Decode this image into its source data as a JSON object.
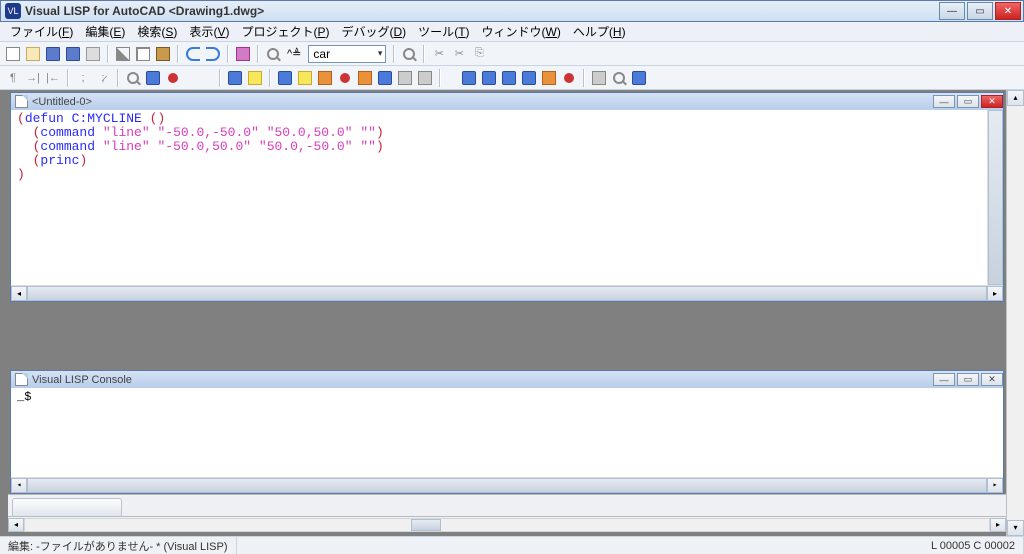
{
  "window": {
    "title": "Visual LISP for AutoCAD <Drawing1.dwg>"
  },
  "menu": [
    {
      "label": "ファイル",
      "accel": "F"
    },
    {
      "label": "編集",
      "accel": "E"
    },
    {
      "label": "検索",
      "accel": "S"
    },
    {
      "label": "表示",
      "accel": "V"
    },
    {
      "label": "プロジェクト",
      "accel": "P"
    },
    {
      "label": "デバッグ",
      "accel": "D"
    },
    {
      "label": "ツール",
      "accel": "T"
    },
    {
      "label": "ウィンドウ",
      "accel": "W"
    },
    {
      "label": "ヘルプ",
      "accel": "H"
    }
  ],
  "combo": {
    "value": "car"
  },
  "editor": {
    "title": "<Untitled-0>",
    "code": {
      "l1_kw": "defun",
      "l1_name": "C:MYCLINE",
      "l2_kw": "command",
      "l2_a": "\"line\"",
      "l2_b": "\"-50.0,-50.0\"",
      "l2_c": "\"50.0,50.0\"",
      "l2_d": "\"\"",
      "l3_kw": "command",
      "l3_a": "\"line\"",
      "l3_b": "\"-50.0,50.0\"",
      "l3_c": "\"50.0,-50.0\"",
      "l3_d": "\"\"",
      "l4_kw": "princ"
    }
  },
  "console": {
    "title": "Visual LISP Console",
    "prompt": "_$"
  },
  "status": {
    "edit_label": "編集:",
    "file_text": "-ファイルがありません- * (Visual LISP)",
    "pos": "L 00005 C 00002"
  }
}
